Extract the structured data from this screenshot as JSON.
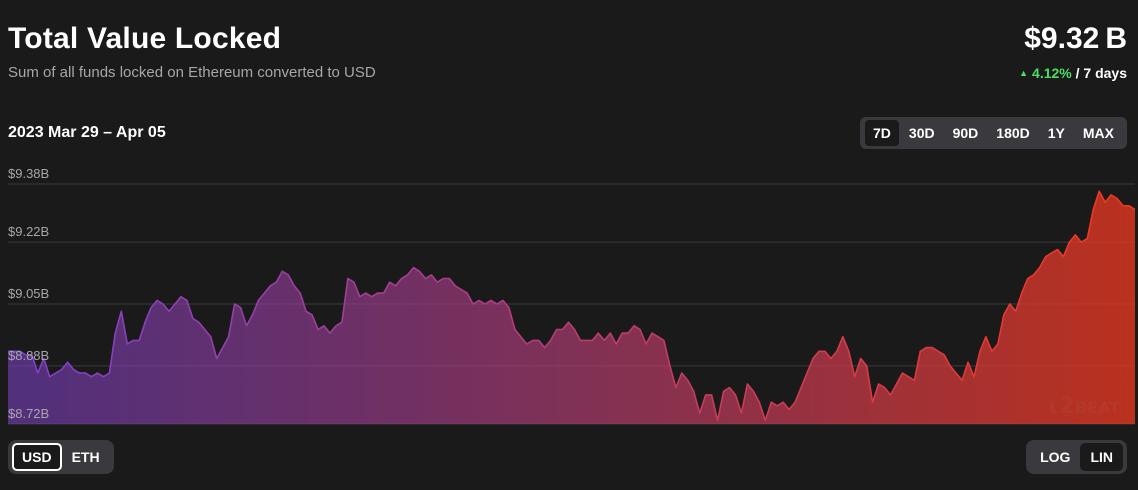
{
  "header": {
    "title": "Total Value Locked",
    "subtitle": "Sum of all funds locked on Ethereum converted to USD",
    "value": "$9.32 B",
    "change_percent": "4.12%",
    "change_period": " / 7 days"
  },
  "date_range": "2023 Mar 29 – Apr 05",
  "range_buttons": [
    {
      "label": "7D",
      "active": true
    },
    {
      "label": "30D",
      "active": false
    },
    {
      "label": "90D",
      "active": false
    },
    {
      "label": "180D",
      "active": false
    },
    {
      "label": "1Y",
      "active": false
    },
    {
      "label": "MAX",
      "active": false
    }
  ],
  "currency_toggle": {
    "options": [
      "USD",
      "ETH"
    ],
    "selected": "USD"
  },
  "scale_toggle": {
    "options": [
      "LOG",
      "LIN"
    ],
    "selected": "LIN"
  },
  "watermark": {
    "lettering": "L2BEAT"
  },
  "colors": {
    "gradient_start": "#7e41cc",
    "gradient_end": "#f0391e",
    "up": "#4ade63",
    "background": "#1a1a1b"
  },
  "chart_data": {
    "type": "area",
    "title": "Total Value Locked",
    "xlabel": "",
    "ylabel": "",
    "y_ticks": [
      "$8.72B",
      "$8.88B",
      "$9.05B",
      "$9.22B",
      "$9.38B"
    ],
    "y_tick_values": [
      8.72,
      8.88,
      9.05,
      9.22,
      9.38
    ],
    "ylim": [
      8.72,
      9.38
    ],
    "grid": true,
    "unit": "billion USD",
    "series": [
      {
        "values": [
          8.92,
          8.92,
          8.92,
          8.91,
          8.91,
          8.86,
          8.9,
          8.85,
          8.86,
          8.87,
          8.89,
          8.87,
          8.86,
          8.86,
          8.85,
          8.86,
          8.85,
          8.86,
          8.97,
          9.03,
          8.94,
          8.95,
          8.95,
          9.0,
          9.04,
          9.06,
          9.05,
          9.03,
          9.05,
          9.07,
          9.06,
          9.01,
          9.0,
          8.98,
          8.96,
          8.9,
          8.93,
          8.96,
          9.05,
          9.04,
          8.99,
          9.02,
          9.06,
          9.08,
          9.1,
          9.11,
          9.14,
          9.13,
          9.1,
          9.08,
          9.03,
          9.02,
          8.98,
          8.99,
          8.97,
          8.99,
          9.0,
          9.12,
          9.11,
          9.07,
          9.08,
          9.07,
          9.08,
          9.08,
          9.11,
          9.1,
          9.12,
          9.13,
          9.15,
          9.14,
          9.12,
          9.13,
          9.11,
          9.12,
          9.12,
          9.1,
          9.09,
          9.08,
          9.05,
          9.06,
          9.05,
          9.06,
          9.05,
          9.06,
          9.04,
          8.98,
          8.96,
          8.94,
          8.95,
          8.95,
          8.93,
          8.95,
          8.98,
          8.98,
          9.0,
          8.98,
          8.95,
          8.95,
          8.95,
          8.97,
          8.95,
          8.97,
          8.94,
          8.97,
          8.97,
          8.99,
          8.98,
          8.94,
          8.97,
          8.96,
          8.95,
          8.88,
          8.82,
          8.86,
          8.84,
          8.81,
          8.75,
          8.8,
          8.8,
          8.73,
          8.81,
          8.82,
          8.8,
          8.75,
          8.83,
          8.81,
          8.78,
          8.73,
          8.78,
          8.77,
          8.78,
          8.76,
          8.78,
          8.82,
          8.86,
          8.9,
          8.92,
          8.92,
          8.9,
          8.92,
          8.96,
          8.92,
          8.85,
          8.9,
          8.88,
          8.78,
          8.83,
          8.82,
          8.8,
          8.83,
          8.86,
          8.85,
          8.84,
          8.92,
          8.93,
          8.93,
          8.92,
          8.91,
          8.88,
          8.86,
          8.84,
          8.89,
          8.85,
          8.92,
          8.96,
          8.92,
          8.94,
          9.02,
          9.05,
          9.03,
          9.08,
          9.12,
          9.13,
          9.15,
          9.18,
          9.19,
          9.2,
          9.18,
          9.22,
          9.24,
          9.22,
          9.23,
          9.31,
          9.36,
          9.33,
          9.35,
          9.34,
          9.32,
          9.32,
          9.31
        ]
      }
    ]
  }
}
